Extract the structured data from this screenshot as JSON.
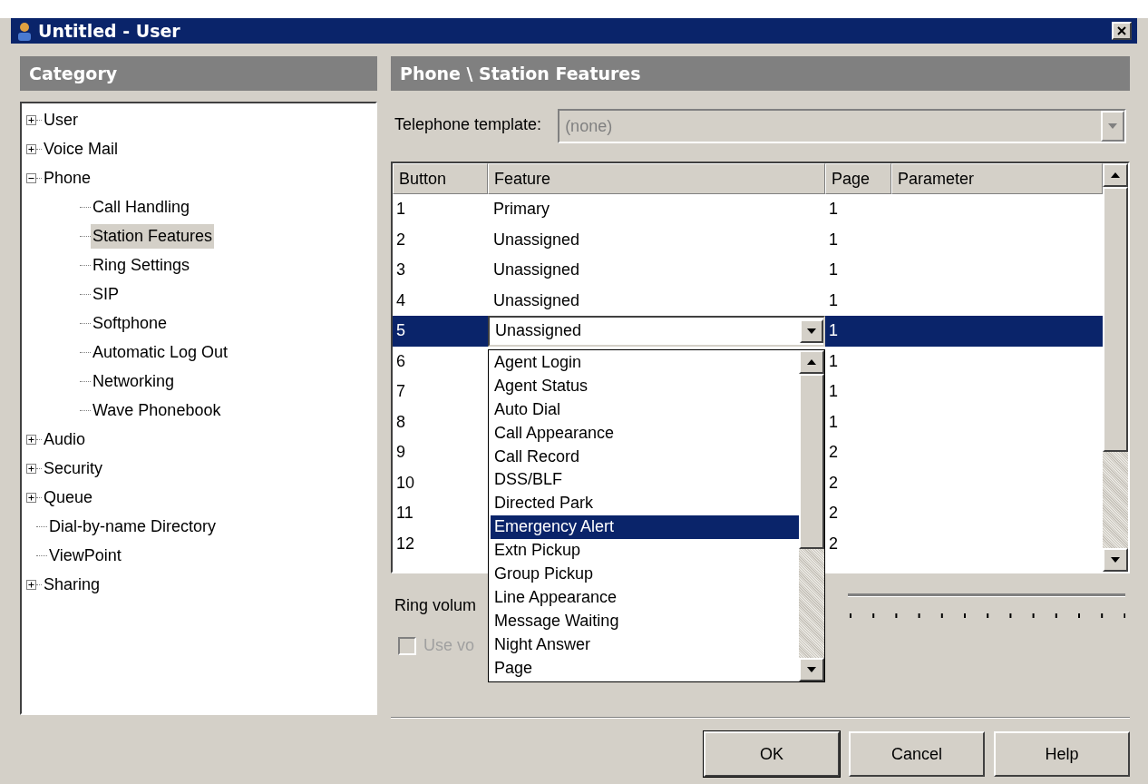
{
  "window": {
    "title": "Untitled - User"
  },
  "category": {
    "title": "Category",
    "tree": [
      {
        "label": "User",
        "expanded": false,
        "selected": false
      },
      {
        "label": "Voice Mail",
        "expanded": false,
        "selected": false
      },
      {
        "label": "Phone",
        "expanded": true,
        "selected": false,
        "children": [
          {
            "label": "Call Handling",
            "selected": false
          },
          {
            "label": "Station Features",
            "selected": true
          },
          {
            "label": "Ring Settings",
            "selected": false
          },
          {
            "label": "SIP",
            "selected": false
          },
          {
            "label": "Softphone",
            "selected": false
          },
          {
            "label": "Automatic Log Out",
            "selected": false
          },
          {
            "label": "Networking",
            "selected": false
          },
          {
            "label": "Wave Phonebook",
            "selected": false
          }
        ]
      },
      {
        "label": "Audio",
        "expanded": false,
        "selected": false
      },
      {
        "label": "Security",
        "expanded": false,
        "selected": false
      },
      {
        "label": "Queue",
        "expanded": false,
        "selected": false
      },
      {
        "label": "Dial-by-name Directory",
        "selected": false
      },
      {
        "label": "ViewPoint",
        "selected": false
      },
      {
        "label": "Sharing",
        "expanded": false,
        "selected": false
      }
    ]
  },
  "panel": {
    "title": "Phone \\ Station Features",
    "template": {
      "label": "Telephone template:",
      "value": "(none)",
      "disabled": true
    },
    "table": {
      "columns": [
        "Button",
        "Feature",
        "Page",
        "Parameter"
      ],
      "rows": [
        {
          "button": "1",
          "feature": "Primary",
          "page": "1",
          "selected": false
        },
        {
          "button": "2",
          "feature": "Unassigned",
          "page": "1",
          "selected": false
        },
        {
          "button": "3",
          "feature": "Unassigned",
          "page": "1",
          "selected": false
        },
        {
          "button": "4",
          "feature": "Unassigned",
          "page": "1",
          "selected": false
        },
        {
          "button": "5",
          "feature": "Unassigned",
          "page": "1",
          "selected": true,
          "editing": true
        },
        {
          "button": "6",
          "page": "1",
          "selected": false
        },
        {
          "button": "7",
          "page": "1",
          "selected": false
        },
        {
          "button": "8",
          "page": "1",
          "selected": false
        },
        {
          "button": "9",
          "page": "2",
          "selected": false
        },
        {
          "button": "10",
          "page": "2",
          "selected": false
        },
        {
          "button": "11",
          "page": "2",
          "selected": false
        },
        {
          "button": "12",
          "page": "2",
          "selected": false
        }
      ]
    },
    "feature_dropdown": {
      "items": [
        {
          "label": "Agent Login",
          "selected": false
        },
        {
          "label": "Agent Status",
          "selected": false
        },
        {
          "label": "Auto Dial",
          "selected": false
        },
        {
          "label": "Call Appearance",
          "selected": false
        },
        {
          "label": "Call Record",
          "selected": false
        },
        {
          "label": "DSS/BLF",
          "selected": false
        },
        {
          "label": "Directed Park",
          "selected": false
        },
        {
          "label": "Emergency Alert",
          "selected": true
        },
        {
          "label": "Extn Pickup",
          "selected": false
        },
        {
          "label": "Group Pickup",
          "selected": false
        },
        {
          "label": "Line Appearance",
          "selected": false
        },
        {
          "label": "Message Waiting",
          "selected": false
        },
        {
          "label": "Night Answer",
          "selected": false
        },
        {
          "label": "Page",
          "selected": false
        }
      ]
    },
    "ring_volume": {
      "label": "Ring volum"
    },
    "use_checkbox": {
      "label": "Use vo",
      "checked": false,
      "disabled": true
    }
  },
  "buttons": [
    {
      "label": "OK",
      "default": true
    },
    {
      "label": "Cancel",
      "default": false
    },
    {
      "label": "Help",
      "default": false
    }
  ]
}
